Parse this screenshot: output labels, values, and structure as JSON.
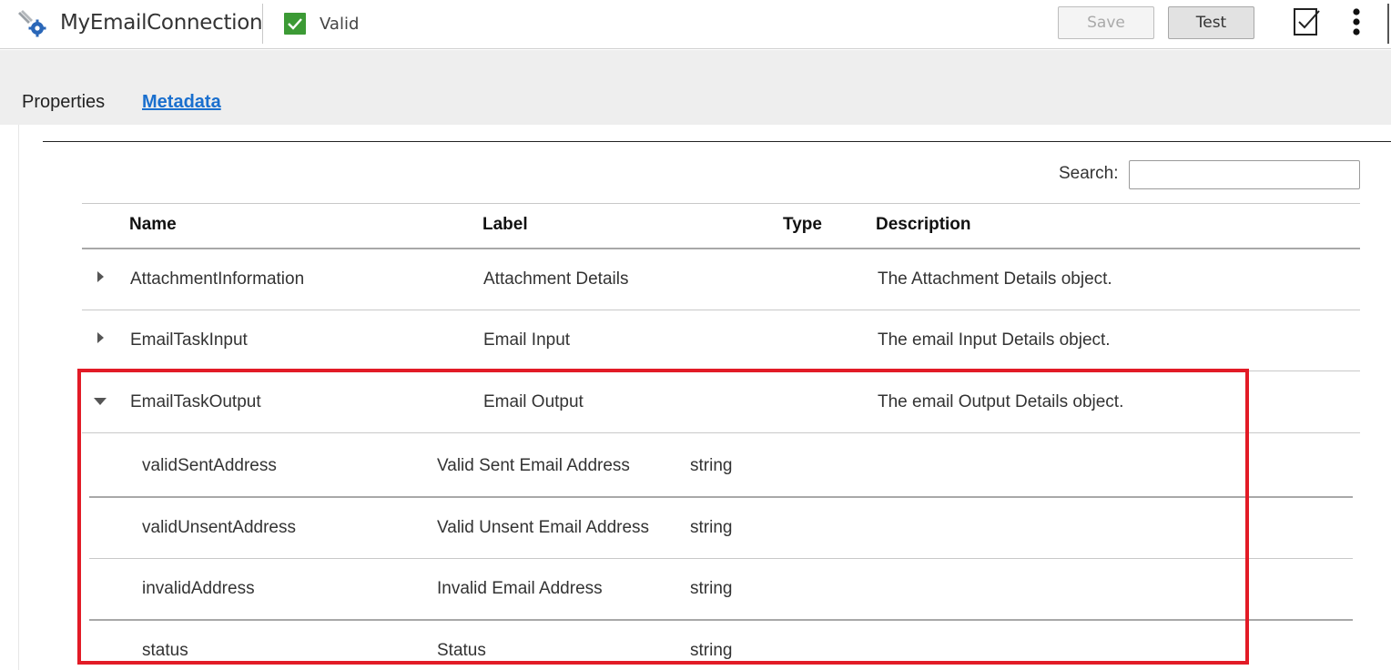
{
  "header": {
    "app_title": "MyEmailConnection",
    "status_label": "Valid",
    "save_label": "Save",
    "test_label": "Test",
    "icons": [
      "connection-gear-icon",
      "check-icon",
      "validate-icon",
      "more-vertical-icon"
    ]
  },
  "tabs": [
    {
      "label": "Properties",
      "active": false
    },
    {
      "label": "Metadata",
      "active": true
    }
  ],
  "search": {
    "label": "Search:",
    "value": "",
    "placeholder": ""
  },
  "table": {
    "columns": [
      "Name",
      "Label",
      "Type",
      "Description"
    ],
    "rows": [
      {
        "name": "AttachmentInformation",
        "label": "Attachment Details",
        "type": "",
        "description": "The Attachment Details object.",
        "expanded": false
      },
      {
        "name": "EmailTaskInput",
        "label": "Email Input",
        "type": "",
        "description": "The email Input Details object.",
        "expanded": false
      },
      {
        "name": "EmailTaskOutput",
        "label": "Email Output",
        "type": "",
        "description": "The email Output Details object.",
        "expanded": true,
        "children": [
          {
            "name": "validSentAddress",
            "label": "Valid Sent Email Address",
            "type": "string"
          },
          {
            "name": "validUnsentAddress",
            "label": "Valid Unsent Email Address",
            "type": "string"
          },
          {
            "name": "invalidAddress",
            "label": "Invalid Email Address",
            "type": "string"
          },
          {
            "name": "status",
            "label": "Status",
            "type": "string"
          }
        ]
      }
    ]
  },
  "colors": {
    "valid_green": "#3c9a35",
    "link_blue": "#1a6fce",
    "highlight_red": "#e21b26",
    "header_bg": "#eeeeee"
  }
}
